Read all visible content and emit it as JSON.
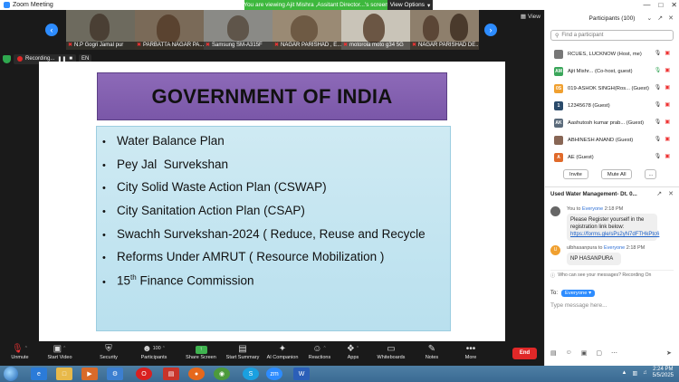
{
  "window": {
    "app_title": "Zoom Meeting",
    "viewing_banner": "You are viewing Ajit Mishra ,Assitant Director...'s screen",
    "view_options": "View Options",
    "controls": [
      "—",
      "□",
      "✕"
    ]
  },
  "thumbnails": [
    {
      "name": "N.P Gogri Jamal pur"
    },
    {
      "name": "PARBATTA NAGAR PA..."
    },
    {
      "name": "Samsung SM-A315F"
    },
    {
      "name": "NAGAR PARISHAD , E..."
    },
    {
      "name": "motorola moto g34 5G"
    },
    {
      "name": "NAGAR PARISHAD DE..."
    }
  ],
  "view_button": "View",
  "recording": {
    "label": "Recording...",
    "pause": "❚❚",
    "stop": "■",
    "language": "EN"
  },
  "slide": {
    "title": "GOVERNMENT OF INDIA",
    "bullets": [
      "Water Balance Plan",
      "Pey Jal  Survekshan",
      "City Solid Waste Action Plan (CSWAP)",
      "City Sanitation Action Plan (CSAP)",
      "Swachh Survekshan-2024 ( Reduce, Reuse and Recycle",
      "Reforms Under AMRUT ( Resource Mobilization )"
    ],
    "last_bullet": {
      "prefix": "15",
      "sup": "th",
      "suffix": " Finance Commission"
    }
  },
  "toolbar": {
    "unmute": "Unmute",
    "start_video": "Start Video",
    "security": "Security",
    "participants": "Participants",
    "participants_count": "100",
    "share_screen": "Share Screen",
    "start_summary": "Start Summary",
    "ai_companion": "AI Companion",
    "reactions": "Reactions",
    "apps": "Apps",
    "whiteboards": "Whiteboards",
    "notes": "Notes",
    "more": "More",
    "end": "End"
  },
  "participants_panel": {
    "title": "Participants (100)",
    "search_placeholder": "Find a participant",
    "list": [
      {
        "name": "RCUES, LUCKNOW (Host, me)",
        "initials": "",
        "color": "#777777"
      },
      {
        "name": "Ajit Mishr... (Co-host, guest)",
        "initials": "AM",
        "color": "#3aa65a"
      },
      {
        "name": "019-ASHOK SINGH(Ros... (Guest)",
        "initials": "0S",
        "color": "#f0a030"
      },
      {
        "name": "12345678 (Guest)",
        "initials": "1",
        "color": "#2a4a6a"
      },
      {
        "name": "Aashutosh kumar prab... (Guest)",
        "initials": "AK",
        "color": "#5a6a7a"
      },
      {
        "name": "ABHINESH ANAND (Guest)",
        "initials": "",
        "color": "#886655"
      },
      {
        "name": "AE (Guest)",
        "initials": "A",
        "color": "#e06a2a"
      }
    ],
    "invite": "Invite",
    "mute_all": "Mute All",
    "more": "..."
  },
  "chat": {
    "title": "Used Water Management-  Dt. 0...",
    "messages": [
      {
        "from": "You",
        "to": "Everyone",
        "time": "2:18 PM",
        "text": "Please Register yourself in the registration link below:",
        "link": "https://forms.gle/sPs2yN7dFTHkPtc6",
        "avatar_color": "#666666"
      },
      {
        "from": "ulbhasanpura",
        "to": "Everyone",
        "time": "2:18 PM",
        "text": "NP HASANPURA",
        "link": "",
        "avatar_color": "#f0a030",
        "initial": "U"
      }
    ],
    "who_can_see": "Who can see your messages? Recording On",
    "to_label": "To:",
    "to_value": "Everyone",
    "input_placeholder": "Type message here..."
  },
  "taskbar": {
    "time": "2:24 PM",
    "date": "5/5/2025"
  }
}
